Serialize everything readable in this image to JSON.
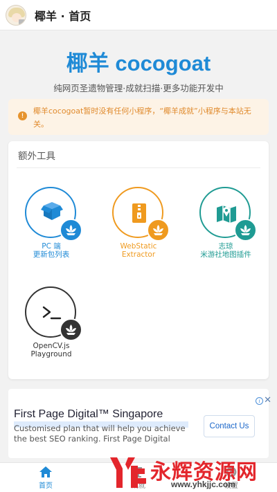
{
  "topbar": {
    "title": "椰羊 · 首页"
  },
  "hero": {
    "title": "椰羊 cocogoat",
    "subtitle": "纯网页圣遗物管理·成就扫描·更多功能开发中"
  },
  "notice": {
    "icon": "info-icon",
    "text": "椰羊cocogoat暂时没有任何小程序，“椰羊成就”小程序与本站无关。"
  },
  "tools_card": {
    "title": "额外工具",
    "items": [
      {
        "line1": "PC 端",
        "line2": "更新包列表",
        "color": "#1f8ad6",
        "icon": "package-icon"
      },
      {
        "line1": "WebStatic",
        "line2": "Extractor",
        "color": "#ef9a1f",
        "icon": "zip-file-icon"
      },
      {
        "line1": "志琼",
        "line2": "米游社地图插件",
        "color": "#1f9b93",
        "icon": "map-icon"
      },
      {
        "line1": "OpenCV.js",
        "line2": "Playground",
        "color": "#333333",
        "icon": "terminal-icon"
      }
    ]
  },
  "ad": {
    "headline": "First Page Digital™ Singapore",
    "body": "Customised plan that will help you achieve the best SEO ranking. First Page Digital",
    "button": "Contact Us"
  },
  "bottom_nav": {
    "items": [
      {
        "label": "首页",
        "icon": "home-icon"
      },
      {
        "label": "成就",
        "icon": "trophy-icon"
      },
      {
        "label": "设置",
        "icon": "settings-icon"
      }
    ]
  },
  "watermark": {
    "text": "永辉资源网",
    "url": "www.yhkjjc.com"
  },
  "colors": {
    "accent": "#1f8ad6",
    "notice": "#e08a2c",
    "notice_bg": "#fdf3e6",
    "watermark": "#e3262c"
  }
}
